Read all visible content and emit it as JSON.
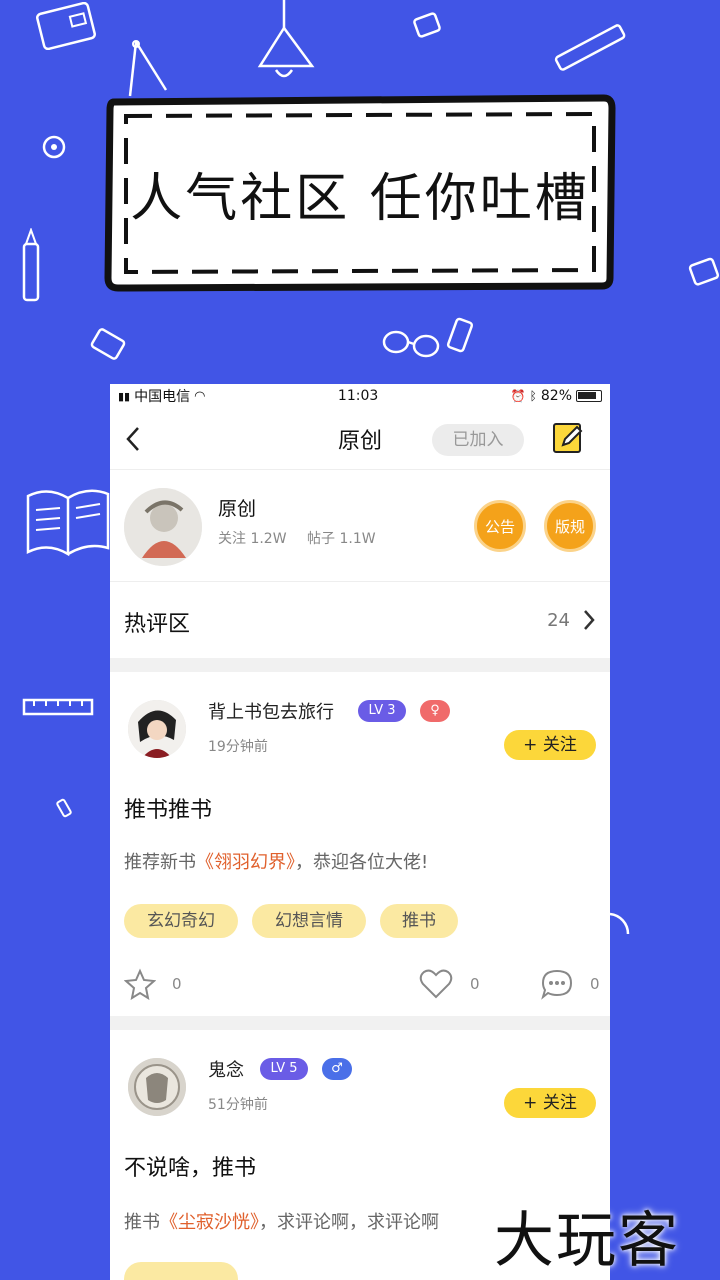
{
  "banner": {
    "text": "人气社区  任你吐槽"
  },
  "status_bar": {
    "carrier": "中国电信",
    "time": "11:03",
    "battery": "82%"
  },
  "nav": {
    "back_icon": "chevron-left-icon",
    "title": "原创",
    "joined_label": "已加入",
    "edit_icon": "edit-note-icon"
  },
  "community": {
    "name": "原创",
    "follow_stat": "关注 1.2W",
    "post_stat": "帖子 1.1W",
    "notice_label": "公告",
    "rules_label": "版规"
  },
  "hot_section": {
    "title": "热评区",
    "count": "24"
  },
  "posts": [
    {
      "username": "背上书包去旅行",
      "level": "LV 3",
      "time": "19分钟前",
      "follow_label": "+ 关注",
      "title": "推书推书",
      "body_prefix": "推荐新书",
      "book": "《翎羽幻界》",
      "body_suffix": "，恭迎各位大佬!",
      "tags": [
        "玄幻奇幻",
        "幻想言情",
        "推书"
      ],
      "star_count": "0",
      "like_count": "0",
      "comment_count": "0"
    },
    {
      "username": "鬼念",
      "level": "LV 5",
      "time": "51分钟前",
      "follow_label": "+ 关注",
      "title": "不说啥，推书",
      "body_prefix": "推书",
      "book": "《尘寂沙恍》",
      "body_suffix": "，求评论啊，求评论啊"
    }
  ],
  "watermark": "大玩客",
  "colors": {
    "background": "#4155e6",
    "accent_orange": "#f4a21a",
    "follow_yellow": "#fcd73a",
    "tag_yellow": "#fbe9a2",
    "level_purple": "#6a5ce6",
    "book_orange": "#e0602c"
  }
}
